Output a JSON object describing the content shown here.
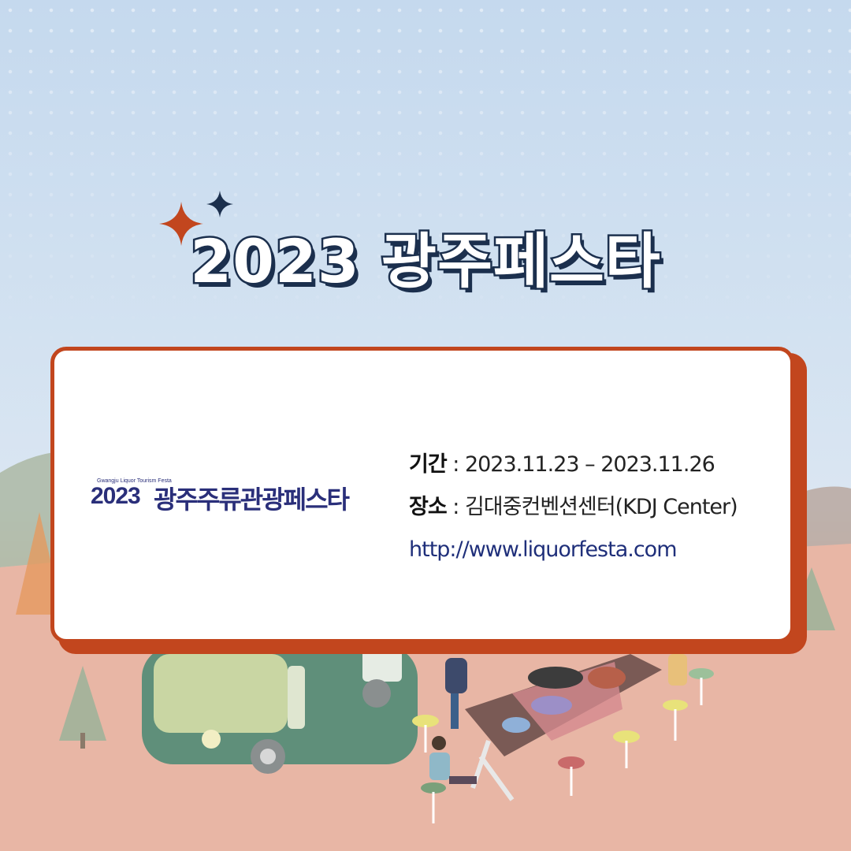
{
  "title": "2023 광주페스타",
  "logo": {
    "small_text": "Gwangju Liquor Tourism Festa",
    "year": "2023",
    "name": "광주주류관광페스타"
  },
  "info": {
    "period_label": "기간",
    "period_value": "2023.11.23 – 2023.11.26",
    "venue_label": "장소",
    "venue_value": "김대중컨벤션센터(KDJ Center)",
    "url": "http://www.liquorfesta.com"
  },
  "colors": {
    "accent": "#c2461e",
    "navy": "#1b2f4d",
    "logo_blue": "#2a2f7a"
  }
}
